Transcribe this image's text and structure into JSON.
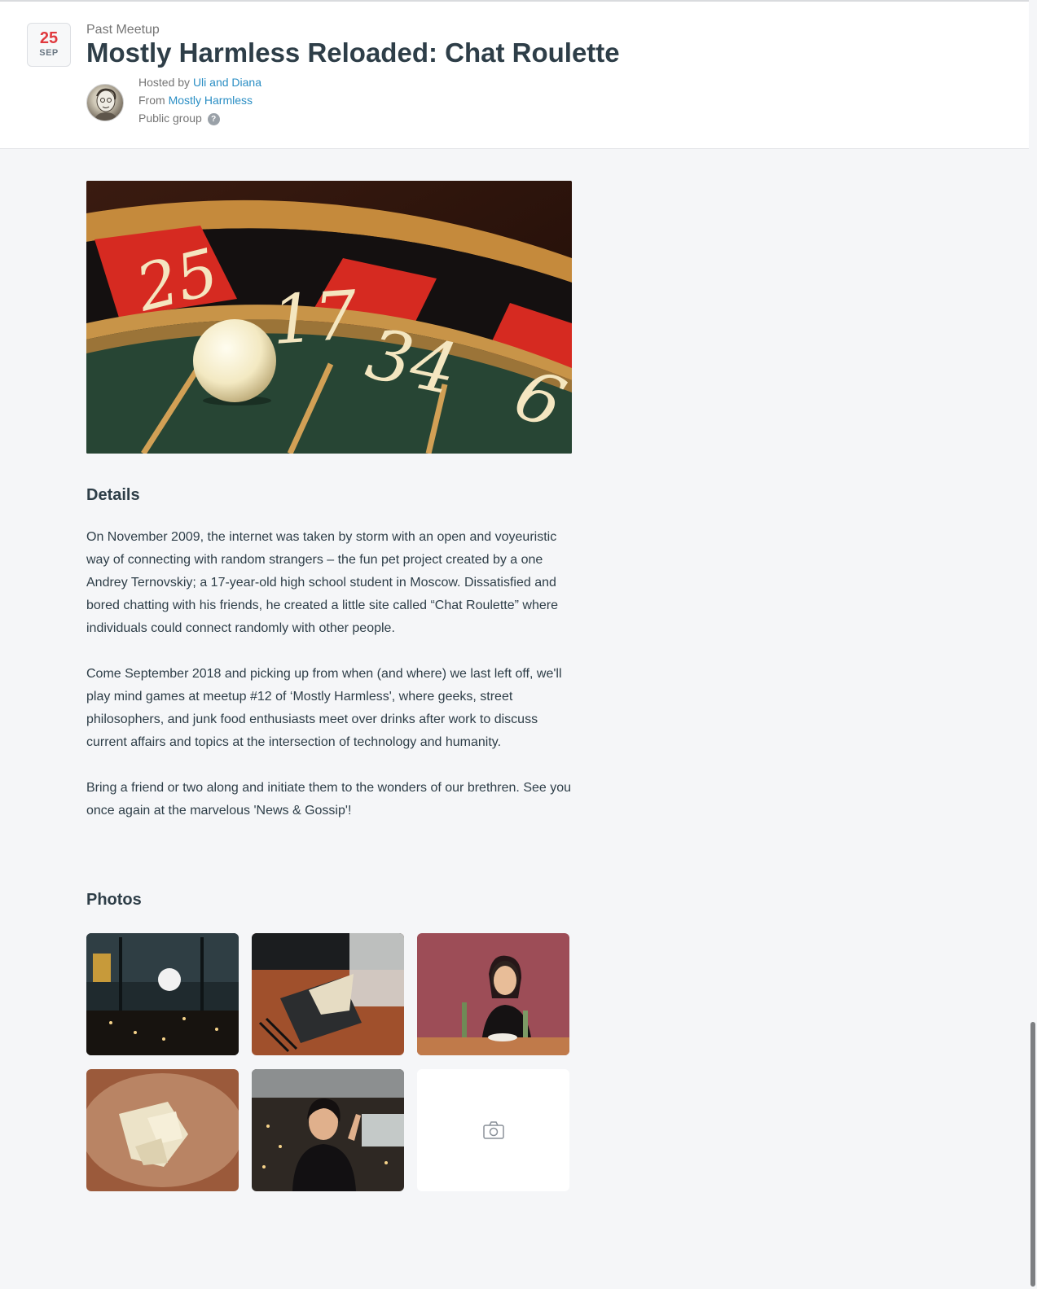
{
  "event": {
    "date": {
      "day": "25",
      "month": "SEP"
    },
    "status": "Past Meetup",
    "title": "Mostly Harmless Reloaded: Chat Roulette",
    "hosted_prefix": "Hosted by",
    "hosts": "Uli and Diana",
    "from_prefix": "From",
    "group": "Mostly Harmless",
    "visibility": "Public group",
    "help_glyph": "?"
  },
  "hero": {
    "numbers": [
      "25",
      "17",
      "34",
      "6"
    ]
  },
  "details": {
    "heading": "Details",
    "paragraphs": [
      "On November 2009, the internet was taken by storm with an open and voyeuristic way of connecting with random strangers – the fun pet project created by a one Andrey Ternovskiy; a 17-year-old high school student in Moscow. Dissatisfied and bored chatting with his friends, he created a little site called “Chat Roulette” where individuals could connect randomly with other people.",
      "Come September 2018 and picking up from when (and where) we last left off, we'll play mind games at meetup #12 of ‘Mostly Harmless', where geeks, street philosophers, and junk food enthusiasts meet over drinks after work to discuss current affairs and topics at the intersection of technology and humanity.",
      "Bring a friend or two along and initiate them to the wonders of our brethren. See you once again at the marvelous 'News & Gossip'!"
    ]
  },
  "photos": {
    "heading": "Photos",
    "add_icon": "camera-icon"
  },
  "colors": {
    "accent_red": "#e0393e",
    "link_blue": "#2a8ec4",
    "text_dark": "#2e3e48",
    "text_muted": "#757575",
    "page_bg": "#f5f6f8"
  }
}
